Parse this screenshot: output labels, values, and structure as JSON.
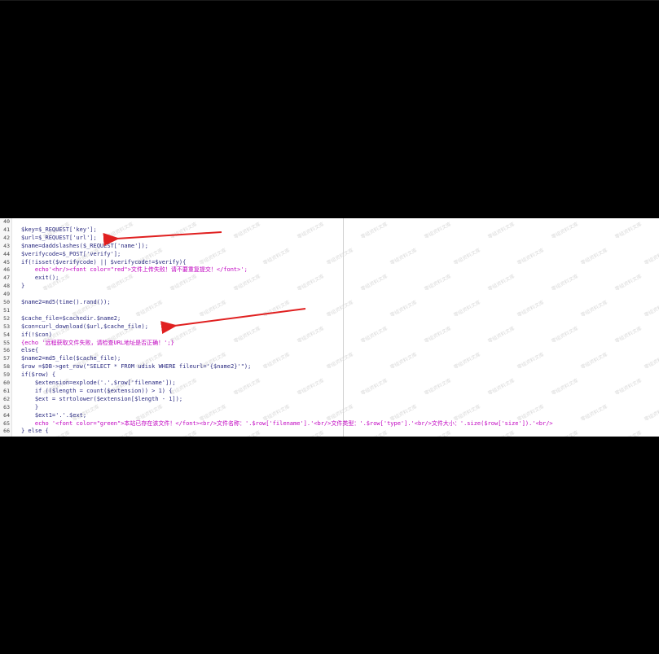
{
  "lines": [
    {
      "n": "40",
      "text": ""
    },
    {
      "n": "41",
      "text": "$key=$_REQUEST['key'];"
    },
    {
      "n": "42",
      "text": "$url=$_REQUEST['url'];"
    },
    {
      "n": "43",
      "text": "$name=daddslashes($_REQUEST['name']);"
    },
    {
      "n": "44",
      "text": "$verifycode=$_POST['verify'];"
    },
    {
      "n": "45",
      "text": "if(!isset($verifycode) || $verifycode!=$verify){"
    },
    {
      "n": "46",
      "text": "    echo'<hr/><font color=\"red\">文件上传失败！请不要重复提交！</font>';"
    },
    {
      "n": "47",
      "text": "    exit();"
    },
    {
      "n": "48",
      "text": "}"
    },
    {
      "n": "49",
      "text": ""
    },
    {
      "n": "50",
      "text": "$name2=md5(time().rand());"
    },
    {
      "n": "51",
      "text": ""
    },
    {
      "n": "52",
      "text": "$cache_file=$cachedir.$name2;"
    },
    {
      "n": "53",
      "text": "$con=curl_download($url,$cache_file);"
    },
    {
      "n": "54",
      "text": "if(!$con)"
    },
    {
      "n": "55",
      "text": "{echo '远程获取文件失败，请检查URL地址是否正确！';}"
    },
    {
      "n": "56",
      "text": "else{"
    },
    {
      "n": "57",
      "text": "$name2=md5_file($cache_file);"
    },
    {
      "n": "58",
      "text": "$row =$DB->get_row(\"SELECT * FROM udisk WHERE fileurl='{$name2}'\");"
    },
    {
      "n": "59",
      "text": "if($row) {"
    },
    {
      "n": "60",
      "text": "    $extension=explode('.',$row['filename']);"
    },
    {
      "n": "61",
      "text": "    if (($length = count($extension)) > 1) {"
    },
    {
      "n": "62",
      "text": "    $ext = strtolower($extension[$length - 1]);"
    },
    {
      "n": "63",
      "text": "    }"
    },
    {
      "n": "64",
      "text": "    $ext1='.'.$ext;"
    },
    {
      "n": "65",
      "text": "    echo '<font color=\"green\">本站已存在该文件！</font><br/>文件名称：'.$row['filename'].'<br/>文件类型：'.$row['type'].'<br/>文件大小：'.size($row['size']).'<br/>"
    },
    {
      "n": "66",
      "text": "} else {"
    }
  ],
  "watermark": "零组资料文库",
  "colors": {
    "background": "#000000",
    "editor": "#ffffff",
    "arrow": "#e02020"
  }
}
